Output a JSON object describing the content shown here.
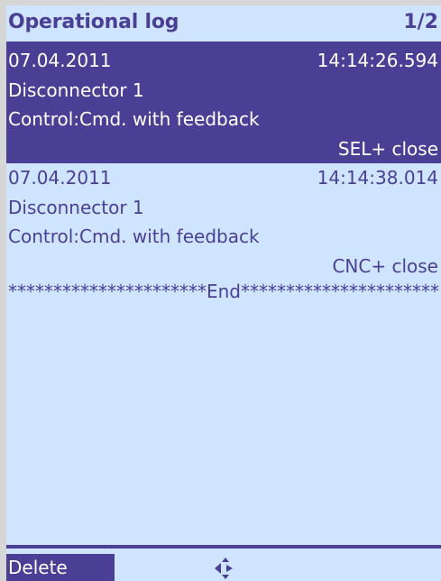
{
  "header": {
    "title": "Operational log",
    "page": "1/2"
  },
  "entries": [
    {
      "date": "07.04.2011",
      "time": "14:14:26.594",
      "device": "Disconnector 1",
      "control": "Control:Cmd. with feedback",
      "action": "SEL+ close",
      "selected": true
    },
    {
      "date": "07.04.2011",
      "time": "14:14:38.014",
      "device": "Disconnector 1",
      "control": "Control:Cmd. with feedback",
      "action": "CNC+ close",
      "selected": false
    }
  ],
  "end_marker": "**********************End**********************",
  "softkeys": {
    "delete_label": "Delete",
    "nav_icon": "navigation-arrows-icon"
  },
  "colors": {
    "background": "#cfe5ff",
    "accent": "#4a3f95",
    "frame": "#d6d6d6",
    "selected_text": "#ffffff"
  }
}
